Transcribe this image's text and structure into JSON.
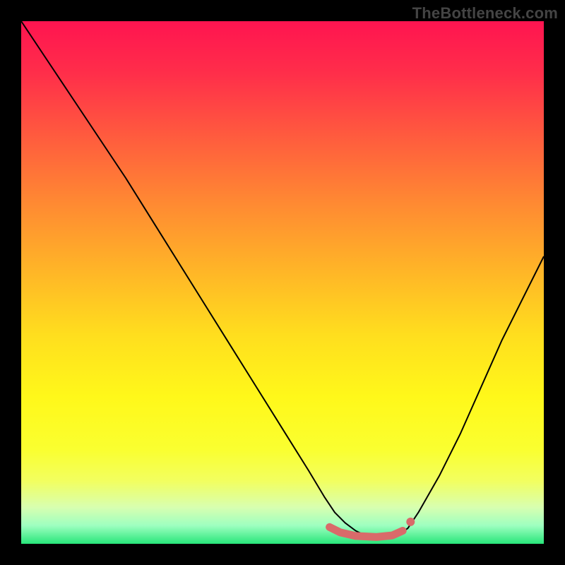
{
  "watermark": "TheBottleneck.com",
  "chart_data": {
    "type": "line",
    "title": "",
    "xlabel": "",
    "ylabel": "",
    "xlim": [
      0,
      100
    ],
    "ylim": [
      0,
      100
    ],
    "grid": false,
    "legend": false,
    "background_gradient": {
      "stops": [
        {
          "offset": 0.0,
          "color": "#ff1450"
        },
        {
          "offset": 0.1,
          "color": "#ff2e4a"
        },
        {
          "offset": 0.22,
          "color": "#ff5b3e"
        },
        {
          "offset": 0.35,
          "color": "#ff8a32"
        },
        {
          "offset": 0.48,
          "color": "#ffb627"
        },
        {
          "offset": 0.6,
          "color": "#ffde1e"
        },
        {
          "offset": 0.72,
          "color": "#fff81a"
        },
        {
          "offset": 0.82,
          "color": "#faff30"
        },
        {
          "offset": 0.88,
          "color": "#f2ff60"
        },
        {
          "offset": 0.93,
          "color": "#d8ffb0"
        },
        {
          "offset": 0.965,
          "color": "#9effc0"
        },
        {
          "offset": 1.0,
          "color": "#28e67a"
        }
      ]
    },
    "series": [
      {
        "name": "bottleneck-curve",
        "color": "#000000",
        "stroke_width": 2,
        "x": [
          0,
          5,
          10,
          15,
          20,
          25,
          30,
          35,
          40,
          45,
          50,
          55,
          58,
          60,
          62,
          64,
          66,
          68,
          70,
          72,
          74,
          76,
          80,
          84,
          88,
          92,
          96,
          100
        ],
        "y": [
          100,
          92.5,
          85,
          77.5,
          70,
          62,
          54,
          46,
          38,
          30,
          22,
          14,
          9,
          6,
          4,
          2.5,
          1.5,
          1,
          1,
          1.5,
          3,
          6,
          13,
          21,
          30,
          39,
          47,
          55
        ]
      }
    ],
    "highlight": {
      "name": "optimal-zone",
      "color": "#d96a6a",
      "stroke_width": 11,
      "linecap": "round",
      "points": [
        {
          "x": 59,
          "y": 3.2
        },
        {
          "x": 61,
          "y": 2.2
        },
        {
          "x": 64,
          "y": 1.5
        },
        {
          "x": 68,
          "y": 1.3
        },
        {
          "x": 71,
          "y": 1.6
        },
        {
          "x": 73,
          "y": 2.5
        }
      ],
      "end_dot": {
        "x": 74.5,
        "y": 4.2,
        "r": 6
      }
    }
  }
}
